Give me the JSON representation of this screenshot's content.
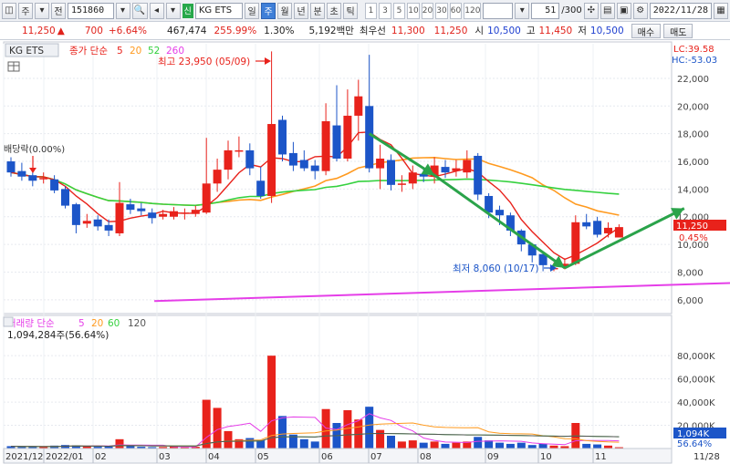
{
  "toolbar": {
    "market_btn": "주",
    "type_btn": "전",
    "code": "151860",
    "search_icon": "search-icon",
    "tag": "신",
    "stock_name": "KG ETS",
    "periods": [
      "일",
      "주",
      "월",
      "년",
      "분",
      "초",
      "틱"
    ],
    "selected_period": "주",
    "intervals": [
      "1",
      "3",
      "5",
      "10",
      "20",
      "30",
      "60",
      "120"
    ],
    "count": "51",
    "count_total": "/300",
    "date": "2022/11/28"
  },
  "quote": {
    "price": "11,250",
    "change": "700",
    "change_pct": "+6.64%",
    "volume": "467,474",
    "volume_ratio": "255.99%",
    "turnover_ratio": "1.30%",
    "amount": "5,192백만",
    "best_ask_label": "최우선",
    "best_ask": "11,300",
    "best_bid": "11,250",
    "open_label": "시",
    "open": "10,500",
    "high_label": "고",
    "high": "11,450",
    "low_label": "저",
    "low": "10,500",
    "buy_btn": "매수",
    "sell_btn": "매도"
  },
  "colors": {
    "up": "#e8221b",
    "down": "#1c55c8",
    "ma5": "#e8221b",
    "ma20": "#ff9a1f",
    "ma52": "#35d13f",
    "ma260": "#e53ee8",
    "arrow": "#2aa34a"
  },
  "price_panel": {
    "legend": {
      "name": "KG ETS",
      "title": "종가 단순",
      "periods": [
        "5",
        "20",
        "52",
        "260"
      ]
    },
    "lc": "LC:39.58",
    "hc": "HC:-53.03",
    "dividend_label": "배당락(0.00%)",
    "high_label": "최고 23,950 (05/09)",
    "low_label": "최저 8,060 (10/17)",
    "current_price_tag": "11,250",
    "current_pct_tag": "0.45%",
    "yaxis": [
      "22,000",
      "20,000",
      "18,000",
      "16,000",
      "14,000",
      "12,000",
      "10,000",
      "8,000",
      "6,000"
    ]
  },
  "volume_panel": {
    "legend": {
      "title": "거래량 단순",
      "periods": [
        "5",
        "20",
        "60",
        "120"
      ]
    },
    "summary": "1,094,284주(56.64%)",
    "current_tag": "1,094K",
    "current_pct": "56.64%",
    "yaxis": [
      "80,000K",
      "60,000K",
      "40,000K",
      "20,000K"
    ]
  },
  "xaxis": {
    "labels": [
      "2021/12",
      "2022/01",
      "02",
      "03",
      "04",
      "05",
      "06",
      "07",
      "08",
      "09",
      "10",
      "11"
    ],
    "right_label": "11/28"
  },
  "chart_data": {
    "type": "candlestick",
    "interval": "weekly",
    "price_range": [
      5000,
      24500
    ],
    "volume_unit": "thousand shares",
    "volume_range": [
      0,
      88000
    ],
    "candles": [
      {
        "o": 16000,
        "c": 15200,
        "h": 16300,
        "l": 14900,
        "v": 2000
      },
      {
        "o": 15300,
        "c": 14900,
        "h": 15900,
        "l": 14600,
        "v": 1500
      },
      {
        "o": 15000,
        "c": 14600,
        "h": 15300,
        "l": 14200,
        "v": 1800
      },
      {
        "o": 14700,
        "c": 14800,
        "h": 15200,
        "l": 14400,
        "v": 1200
      },
      {
        "o": 14700,
        "c": 13900,
        "h": 15000,
        "l": 13700,
        "v": 2500
      },
      {
        "o": 14000,
        "c": 12800,
        "h": 14200,
        "l": 12600,
        "v": 3000
      },
      {
        "o": 12900,
        "c": 11400,
        "h": 13000,
        "l": 10800,
        "v": 2800
      },
      {
        "o": 11500,
        "c": 11700,
        "h": 12200,
        "l": 11200,
        "v": 1800
      },
      {
        "o": 11800,
        "c": 11300,
        "h": 12100,
        "l": 11000,
        "v": 1500
      },
      {
        "o": 11400,
        "c": 11000,
        "h": 11800,
        "l": 10600,
        "v": 1600
      },
      {
        "o": 10800,
        "c": 13000,
        "h": 14500,
        "l": 10600,
        "v": 8000
      },
      {
        "o": 12900,
        "c": 12500,
        "h": 13300,
        "l": 12200,
        "v": 2000
      },
      {
        "o": 12600,
        "c": 12400,
        "h": 13000,
        "l": 12100,
        "v": 1500
      },
      {
        "o": 12300,
        "c": 11900,
        "h": 12600,
        "l": 11500,
        "v": 1200
      },
      {
        "o": 12000,
        "c": 12200,
        "h": 12500,
        "l": 11800,
        "v": 1300
      },
      {
        "o": 12000,
        "c": 12400,
        "h": 12700,
        "l": 11800,
        "v": 1800
      },
      {
        "o": 12300,
        "c": 12300,
        "h": 12600,
        "l": 11800,
        "v": 1000
      },
      {
        "o": 12200,
        "c": 12500,
        "h": 12800,
        "l": 12000,
        "v": 1500
      },
      {
        "o": 12300,
        "c": 14400,
        "h": 17700,
        "l": 12200,
        "v": 42000
      },
      {
        "o": 14400,
        "c": 15400,
        "h": 16200,
        "l": 13800,
        "v": 35000
      },
      {
        "o": 15400,
        "c": 16800,
        "h": 17500,
        "l": 14700,
        "v": 15000
      },
      {
        "o": 16700,
        "c": 16800,
        "h": 17800,
        "l": 16300,
        "v": 8000
      },
      {
        "o": 16800,
        "c": 15500,
        "h": 17300,
        "l": 15000,
        "v": 9000
      },
      {
        "o": 14600,
        "c": 13500,
        "h": 15600,
        "l": 13300,
        "v": 7000
      },
      {
        "o": 13500,
        "c": 18700,
        "h": 23950,
        "l": 13000,
        "v": 80000
      },
      {
        "o": 19000,
        "c": 16500,
        "h": 19300,
        "l": 16000,
        "v": 28000
      },
      {
        "o": 16600,
        "c": 15700,
        "h": 17400,
        "l": 15300,
        "v": 12000
      },
      {
        "o": 16100,
        "c": 15500,
        "h": 16800,
        "l": 15300,
        "v": 8000
      },
      {
        "o": 15700,
        "c": 15300,
        "h": 16100,
        "l": 14700,
        "v": 6000
      },
      {
        "o": 15300,
        "c": 18900,
        "h": 20200,
        "l": 15000,
        "v": 34000
      },
      {
        "o": 18600,
        "c": 16200,
        "h": 21500,
        "l": 16000,
        "v": 22000
      },
      {
        "o": 16200,
        "c": 19300,
        "h": 21200,
        "l": 16000,
        "v": 33000
      },
      {
        "o": 19300,
        "c": 20700,
        "h": 21900,
        "l": 17500,
        "v": 25000
      },
      {
        "o": 20000,
        "c": 15500,
        "h": 23700,
        "l": 15200,
        "v": 36000
      },
      {
        "o": 15500,
        "c": 16200,
        "h": 17200,
        "l": 14000,
        "v": 16000
      },
      {
        "o": 16100,
        "c": 14300,
        "h": 16500,
        "l": 13900,
        "v": 11000
      },
      {
        "o": 14300,
        "c": 14400,
        "h": 15000,
        "l": 13800,
        "v": 6000
      },
      {
        "o": 14400,
        "c": 15200,
        "h": 15700,
        "l": 14000,
        "v": 7000
      },
      {
        "o": 15100,
        "c": 14900,
        "h": 15600,
        "l": 14500,
        "v": 5000
      },
      {
        "o": 14900,
        "c": 15700,
        "h": 16300,
        "l": 14400,
        "v": 6000
      },
      {
        "o": 15600,
        "c": 15200,
        "h": 16100,
        "l": 14800,
        "v": 4000
      },
      {
        "o": 15300,
        "c": 15500,
        "h": 16100,
        "l": 14900,
        "v": 5000
      },
      {
        "o": 15200,
        "c": 16100,
        "h": 16800,
        "l": 14800,
        "v": 6000
      },
      {
        "o": 16400,
        "c": 13600,
        "h": 16600,
        "l": 13200,
        "v": 10000
      },
      {
        "o": 13500,
        "c": 12300,
        "h": 13700,
        "l": 11900,
        "v": 7000
      },
      {
        "o": 12500,
        "c": 12100,
        "h": 12800,
        "l": 11400,
        "v": 5000
      },
      {
        "o": 12100,
        "c": 11000,
        "h": 12300,
        "l": 10600,
        "v": 4000
      },
      {
        "o": 11000,
        "c": 10000,
        "h": 11100,
        "l": 9500,
        "v": 5000
      },
      {
        "o": 10000,
        "c": 9200,
        "h": 10100,
        "l": 8700,
        "v": 3000
      },
      {
        "o": 9300,
        "c": 8500,
        "h": 9400,
        "l": 8060,
        "v": 4000
      },
      {
        "o": 8200,
        "c": 8300,
        "h": 8700,
        "l": 8060,
        "v": 2500
      },
      {
        "o": 8400,
        "c": 8600,
        "h": 9000,
        "l": 8200,
        "v": 2000
      },
      {
        "o": 8600,
        "c": 11600,
        "h": 12100,
        "l": 8500,
        "v": 22000
      },
      {
        "o": 11600,
        "c": 11300,
        "h": 12200,
        "l": 11100,
        "v": 4000
      },
      {
        "o": 11700,
        "c": 10700,
        "h": 12000,
        "l": 10500,
        "v": 3500
      },
      {
        "o": 10800,
        "c": 11200,
        "h": 11600,
        "l": 10500,
        "v": 2500
      },
      {
        "o": 10500,
        "c": 11250,
        "h": 11450,
        "l": 10500,
        "v": 1094
      }
    ],
    "ma260": [
      [
        0,
        null
      ],
      [
        1,
        null
      ],
      [
        2,
        null
      ],
      [
        3,
        null
      ],
      [
        4,
        null
      ],
      [
        5,
        null
      ],
      [
        6,
        null
      ],
      [
        7,
        null
      ],
      [
        8,
        null
      ],
      [
        9,
        null
      ],
      [
        10,
        5900
      ],
      [
        56,
        7400
      ]
    ],
    "trend_arrows": [
      {
        "from": [
          33,
          18000
        ],
        "to": [
          39,
          15000
        ]
      },
      {
        "from": [
          39,
          15000
        ],
        "to": [
          51,
          8300
        ]
      },
      {
        "from": [
          51,
          8300
        ],
        "to": [
          62,
          12600
        ]
      }
    ]
  }
}
